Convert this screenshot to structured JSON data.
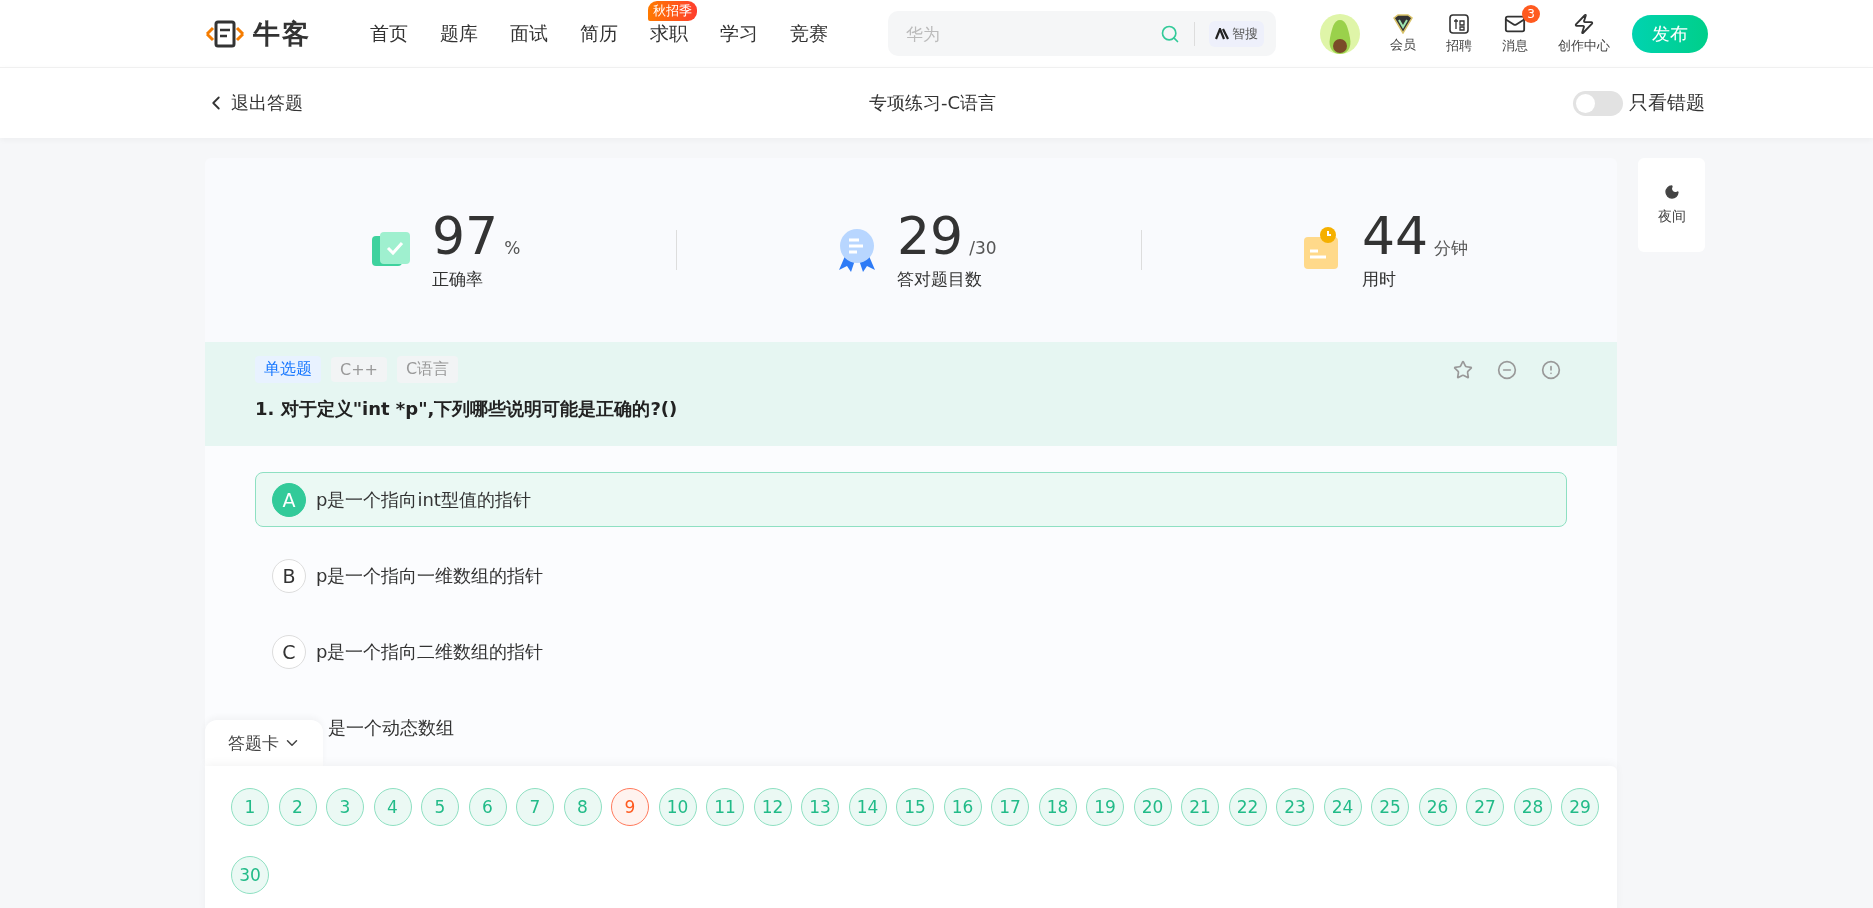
{
  "header": {
    "logo": "牛客",
    "nav": [
      {
        "label": "首页"
      },
      {
        "label": "题库"
      },
      {
        "label": "面试"
      },
      {
        "label": "简历"
      },
      {
        "label": "求职",
        "badge": "秋招季"
      },
      {
        "label": "学习"
      },
      {
        "label": "竞赛"
      }
    ],
    "search": {
      "placeholder": "华为",
      "ai_button": "智搜"
    },
    "actions": [
      {
        "kind": "vip",
        "label": "会员"
      },
      {
        "kind": "recruit",
        "label": "招聘"
      },
      {
        "kind": "message",
        "label": "消息",
        "badge": "3"
      },
      {
        "kind": "create",
        "label": "创作中心"
      }
    ],
    "publish_button": "发布"
  },
  "subheader": {
    "back": "退出答题",
    "title": "专项练习-C语言",
    "toggle": {
      "label": "只看错题",
      "on": false
    }
  },
  "stats": [
    {
      "kind": "accuracy",
      "value": "97",
      "unit": "%",
      "label": "正确率"
    },
    {
      "kind": "correct",
      "value": "29",
      "unit": "/30",
      "label": "答对题目数"
    },
    {
      "kind": "time",
      "value": "44",
      "unit": "分钟",
      "label": "用时"
    }
  ],
  "night_button": "夜间",
  "question": {
    "tags": [
      {
        "kind": "type",
        "label": "单选题"
      },
      {
        "kind": "topic",
        "label": "C++"
      },
      {
        "kind": "topic",
        "label": "C语言"
      }
    ],
    "title": "1. 对于定义\"int *p\",下列哪些说明可能是正确的?()",
    "options": [
      {
        "letter": "A",
        "text": "p是一个指向int型值的指针",
        "selected": true
      },
      {
        "letter": "B",
        "text": "p是一个指向一维数组的指针",
        "selected": false
      },
      {
        "letter": "C",
        "text": "p是一个指向二维数组的指针",
        "selected": false
      },
      {
        "text": "是一个动态数组",
        "selected": false
      }
    ]
  },
  "answer_card": {
    "label": "答题卡",
    "items": [
      {
        "number": "1",
        "wrong": false
      },
      {
        "number": "2",
        "wrong": false
      },
      {
        "number": "3",
        "wrong": false
      },
      {
        "number": "4",
        "wrong": false
      },
      {
        "number": "5",
        "wrong": false
      },
      {
        "number": "6",
        "wrong": false
      },
      {
        "number": "7",
        "wrong": false
      },
      {
        "number": "8",
        "wrong": false
      },
      {
        "number": "9",
        "wrong": true
      },
      {
        "number": "10",
        "wrong": false
      },
      {
        "number": "11",
        "wrong": false
      },
      {
        "number": "12",
        "wrong": false
      },
      {
        "number": "13",
        "wrong": false
      },
      {
        "number": "14",
        "wrong": false
      },
      {
        "number": "15",
        "wrong": false
      },
      {
        "number": "16",
        "wrong": false
      },
      {
        "number": "17",
        "wrong": false
      },
      {
        "number": "18",
        "wrong": false
      },
      {
        "number": "19",
        "wrong": false
      },
      {
        "number": "20",
        "wrong": false
      },
      {
        "number": "21",
        "wrong": false
      },
      {
        "number": "22",
        "wrong": false
      },
      {
        "number": "23",
        "wrong": false
      },
      {
        "number": "24",
        "wrong": false
      },
      {
        "number": "25",
        "wrong": false
      },
      {
        "number": "26",
        "wrong": false
      },
      {
        "number": "27",
        "wrong": false
      },
      {
        "number": "28",
        "wrong": false
      },
      {
        "number": "29",
        "wrong": false
      },
      {
        "number": "30",
        "wrong": false
      }
    ]
  }
}
